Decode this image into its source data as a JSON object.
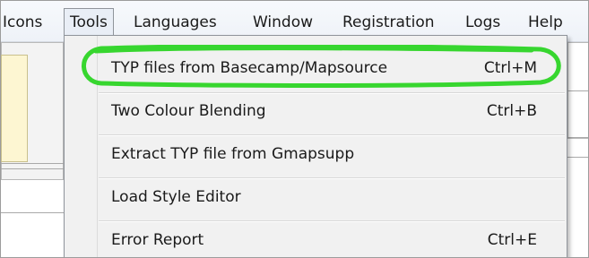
{
  "menubar": {
    "items": [
      {
        "label": "Icons"
      },
      {
        "label": "Tools"
      },
      {
        "label": "Languages"
      },
      {
        "label": "Window"
      },
      {
        "label": "Registration"
      },
      {
        "label": "Logs"
      },
      {
        "label": "Help"
      }
    ]
  },
  "tools_menu": {
    "items": [
      {
        "label": "TYP files from Basecamp/Mapsource",
        "shortcut": "Ctrl+M"
      },
      {
        "label": "Two Colour Blending",
        "shortcut": "Ctrl+B"
      },
      {
        "label": "Extract TYP file from Gmapsupp",
        "shortcut": ""
      },
      {
        "label": "Load Style Editor",
        "shortcut": ""
      },
      {
        "label": "Error Report",
        "shortcut": "Ctrl+E"
      }
    ]
  },
  "annotation": {
    "highlight_color": "#37d62f"
  },
  "colors": {
    "menubar_bg": "#eef2f8",
    "menu_bg": "#f1f1f1",
    "border": "#8f949b"
  }
}
